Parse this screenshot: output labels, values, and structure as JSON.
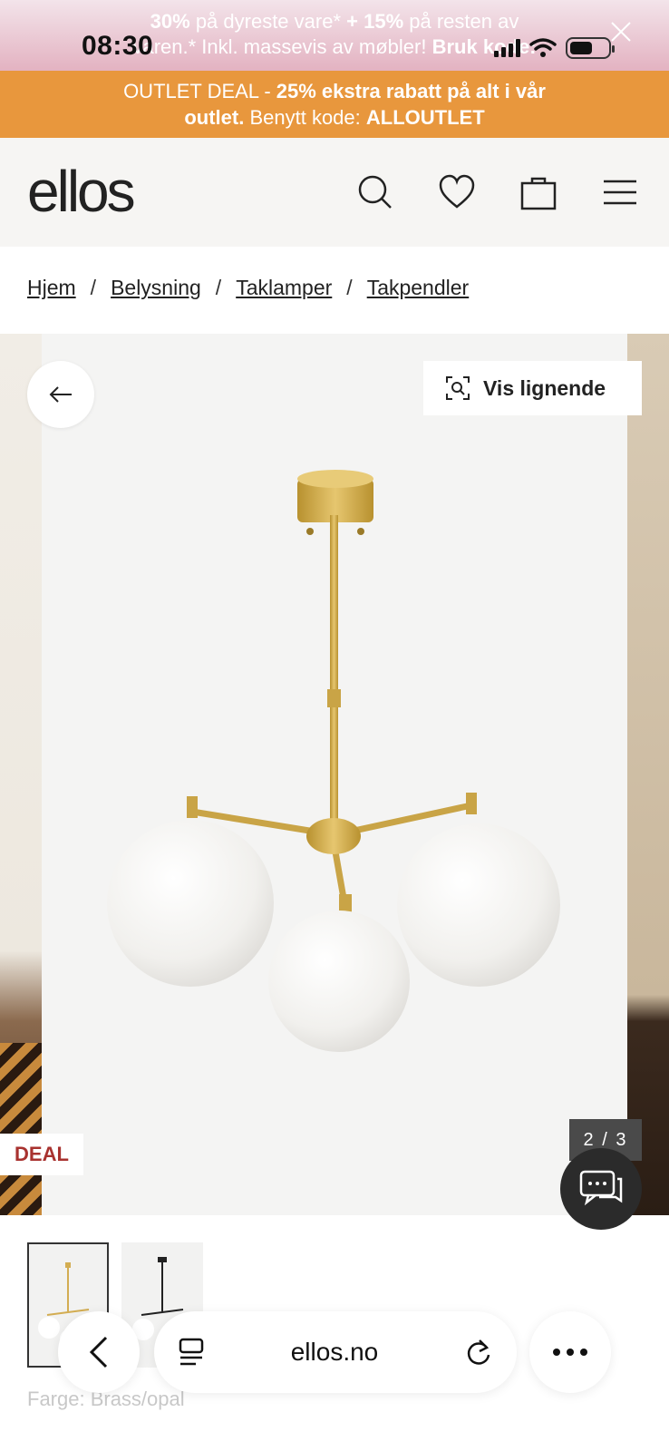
{
  "promo": {
    "line1_bold1": "30%",
    "line1_text1": " på dyreste vare* ",
    "line1_bold2": "+ 15%",
    "line1_text2": " på resten av",
    "line2_text": "varen.* Inkl. massevis av møbler! ",
    "line2_bold": "Bruk kode:"
  },
  "status": {
    "time": "08:30"
  },
  "outlet": {
    "text1": "OUTLET DEAL - ",
    "bold1": "25% ekstra rabatt på alt i vår",
    "bold2": "outlet.",
    "text2": " Benytt kode: ",
    "code": "ALLOUTLET"
  },
  "header": {
    "logo": "ellos",
    "icons": [
      "search-icon",
      "heart-icon",
      "bag-icon",
      "menu-icon"
    ]
  },
  "breadcrumb": [
    "Hjem",
    "Belysning",
    "Taklamper",
    "Takpendler"
  ],
  "gallery": {
    "similar_label": "Vis lignende",
    "deal_badge": "DEAL",
    "counter": "2 / 3",
    "colors": {
      "brass": "#d3ad52",
      "opal": "#f5f4f2",
      "background": "#f4f4f3"
    }
  },
  "product": {
    "color_label": "Farge: Brass/opal"
  },
  "browser": {
    "url": "ellos.no"
  }
}
